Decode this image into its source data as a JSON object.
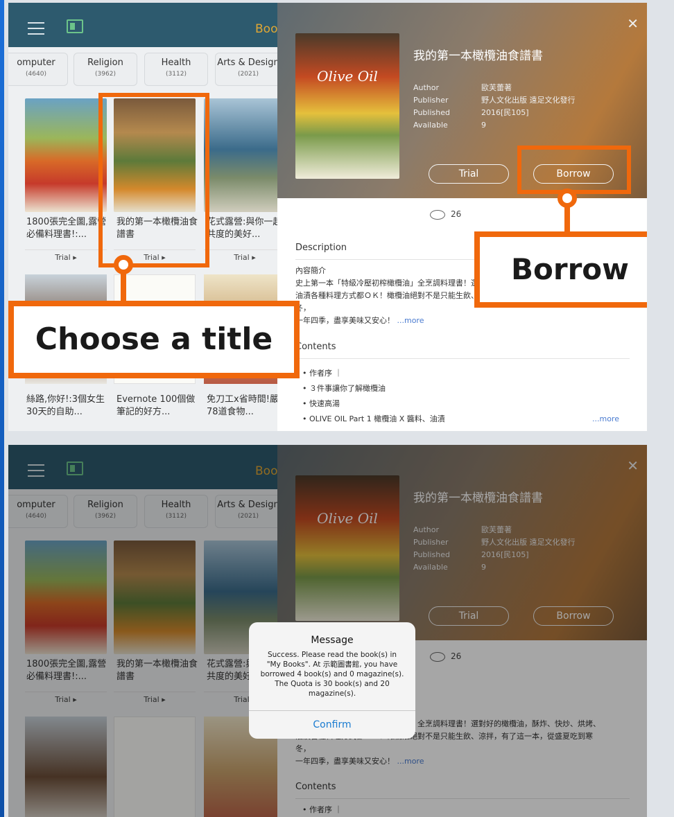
{
  "top": {
    "boo_label": "Boo"
  },
  "categories": [
    {
      "name": "omputer",
      "count": "(4640)"
    },
    {
      "name": "Religion",
      "count": "(3962)"
    },
    {
      "name": "Health",
      "count": "(3112)"
    },
    {
      "name": "Arts & Design",
      "count": "(2021)"
    }
  ],
  "books": [
    {
      "title": "1800張完全圖,露營必備料理書!:..."
    },
    {
      "title": "我的第一本橄欖油食譜書"
    },
    {
      "title": "花式露營:與你一起共度的美好..."
    }
  ],
  "books2": [
    {
      "title": "絲路,你好!:3個女生30天的自助..."
    },
    {
      "title": "Evernote 100個做筆記的好方..."
    },
    {
      "title": "免刀工x省時間!嚴選78道食物..."
    }
  ],
  "trial_label": "Trial",
  "detail": {
    "title": "我的第一本橄欖油食譜書",
    "author_key": "Author",
    "author_val": "歐芙蕾著",
    "publisher_key": "Publisher",
    "publisher_val": "野人文化出版 遠足文化發行",
    "published_key": "Published",
    "published_val": "2016[民105]",
    "available_key": "Available",
    "available_val": "9",
    "cover_text": "Olive Oil",
    "trial_button": "Trial",
    "borrow_button": "Borrow",
    "views": "26",
    "description_heading": "Description",
    "desc_line1": "內容簡介",
    "desc_line2": "史上第一本「特級冷壓初榨橄欖油」全烹調料理書！選對好的橄欖油，酥炸、快炒、烘烤、",
    "desc_line3": "油漬各種料理方式都ＯＫ！橄欖油絕對不是只能生飲、涼拌，有了這一本，從盛夏吃到寒",
    "desc_line4": "冬，",
    "desc_line5": "一年四季，盡享美味又安心！",
    "more": "...more",
    "contents_heading": "Contents",
    "contents": [
      "作者序 ｜",
      "３件事讓你了解橄欖油",
      "快速高湯",
      "OLIVE OIL Part 1 橄欖油 X 醬料、油漬"
    ],
    "contents_more": "...more"
  },
  "callouts": {
    "choose": "Choose a title",
    "borrow": "Borrow"
  },
  "alert": {
    "title": "Message",
    "message": "Success. Please read the book(s) in \"My Books\". At 示範圖書館, you have borrowed 4 book(s) and 0 magazine(s). The Quota is 30 book(s) and 20 magazine(s).",
    "confirm": "Confirm"
  },
  "colors": {
    "highlight": "#f0680c",
    "accent_link": "#4a7bd0",
    "topbar": "#2d5a6e"
  }
}
